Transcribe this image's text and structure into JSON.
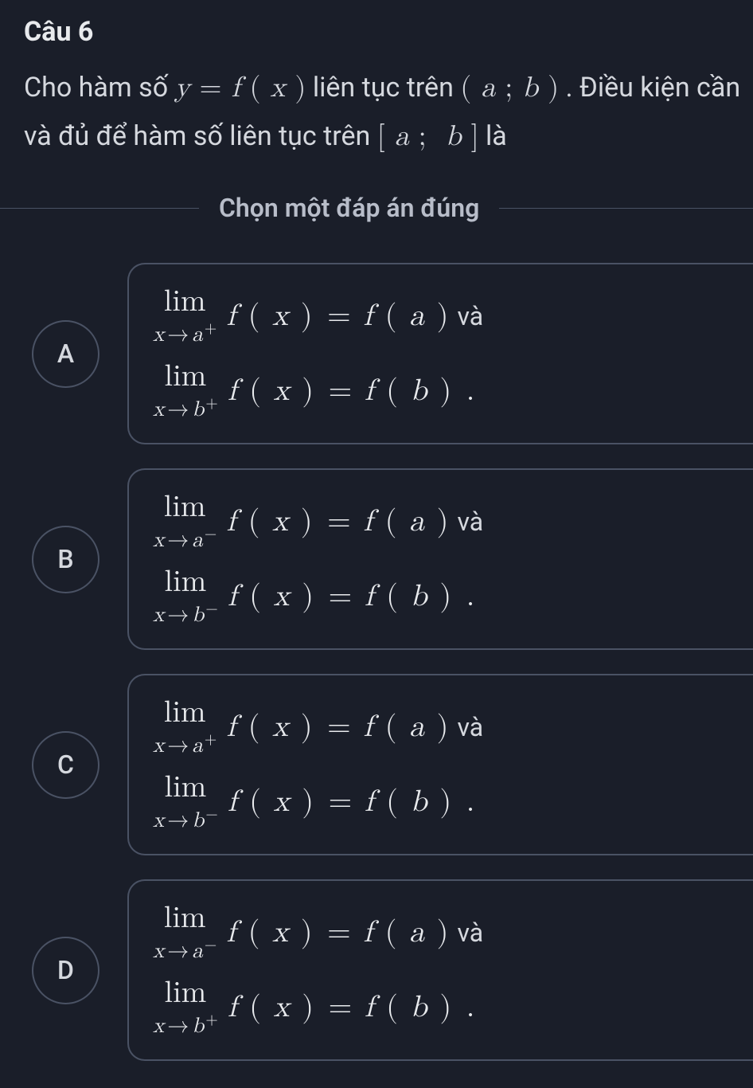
{
  "question": {
    "number": "Câu 6",
    "text_part1": "Cho hàm số ",
    "math1": "y = f ( x )",
    "text_part2": " liên tục trên ",
    "math2": "( a ; b )",
    "text_part3": " . Điều kiện cần và đủ để hàm số liên tục trên ",
    "math3": "[ a ;  b ]",
    "text_part4": " là"
  },
  "instruction": "Chọn một đáp án đúng",
  "options": {
    "A": {
      "letter": "A",
      "line1_sub": "x → a",
      "line1_sup": "+",
      "line1_rhs": "f ( x ) = f ( a )",
      "line1_suffix": "và",
      "line2_sub": "x → b",
      "line2_sup": "+",
      "line2_rhs": "f ( x ) = f ( b ) ."
    },
    "B": {
      "letter": "B",
      "line1_sub": "x → a",
      "line1_sup": "−",
      "line1_rhs": "f ( x ) = f ( a )",
      "line1_suffix": "và",
      "line2_sub": "x → b",
      "line2_sup": "−",
      "line2_rhs": "f ( x ) = f ( b ) ."
    },
    "C": {
      "letter": "C",
      "line1_sub": "x → a",
      "line1_sup": "+",
      "line1_rhs": "f ( x ) = f ( a )",
      "line1_suffix": "và",
      "line2_sub": "x → b",
      "line2_sup": "−",
      "line2_rhs": "f ( x ) = f ( b ) ."
    },
    "D": {
      "letter": "D",
      "line1_sub": "x → a",
      "line1_sup": "−",
      "line1_rhs": "f ( x ) = f ( a )",
      "line1_suffix": "và",
      "line2_sub": "x → b",
      "line2_sup": "+",
      "line2_rhs": "f ( x ) = f ( b ) ."
    }
  },
  "lim_label": "lim"
}
